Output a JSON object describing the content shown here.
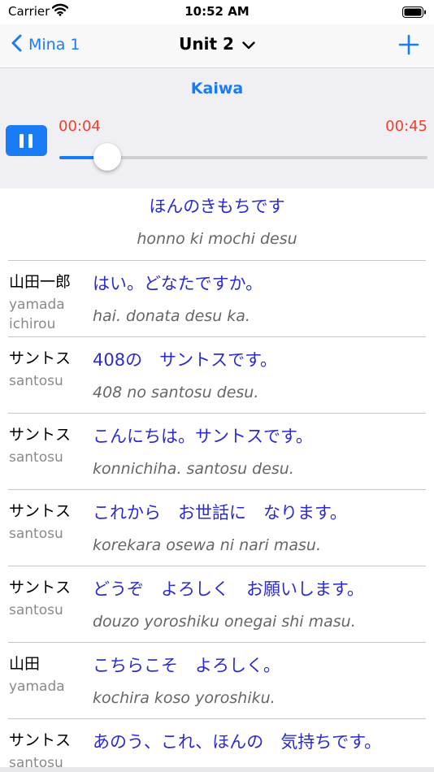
{
  "status_bar": {
    "carrier": "Carrier",
    "time": "10:52 AM"
  },
  "nav": {
    "back_label": "Mina 1",
    "title": "Unit 2"
  },
  "player": {
    "title": "Kaiwa",
    "elapsed": "00:04",
    "duration": "00:45",
    "progress": 0.13
  },
  "dialog": {
    "title_jp": "ほんのきもちです",
    "title_romaji": "honno ki mochi desu",
    "lines": [
      {
        "speaker": "山田一郎",
        "speaker_romaji": "yamada ichirou",
        "jp": "はい。どなたですか。",
        "romaji": "hai. donata desu ka."
      },
      {
        "speaker": "サントス",
        "speaker_romaji": "santosu",
        "jp": "408の　サントスです。",
        "romaji": "408 no santosu desu."
      },
      {
        "speaker": "サントス",
        "speaker_romaji": "santosu",
        "jp": "こんにちは。サントスです。",
        "romaji": "konnichiha. santosu desu."
      },
      {
        "speaker": "サントス",
        "speaker_romaji": "santosu",
        "jp": "これから　お世話に　なります。",
        "romaji": "korekara osewa ni nari masu."
      },
      {
        "speaker": "サントス",
        "speaker_romaji": "santosu",
        "jp": "どうぞ　よろしく　お願いします。",
        "romaji": "douzo yoroshiku onegai shi masu."
      },
      {
        "speaker": "山田",
        "speaker_romaji": "yamada",
        "jp": "こちらこそ　よろしく。",
        "romaji": "kochira koso yoroshiku."
      },
      {
        "speaker": "サントス",
        "speaker_romaji": "santosu",
        "jp": "あのう、これ、ほんの　気持ちです。",
        "romaji": ""
      }
    ]
  },
  "colors": {
    "accent": "#1a7cf4",
    "time_red": "#f0402c",
    "jp_text": "#2b2bd0"
  }
}
